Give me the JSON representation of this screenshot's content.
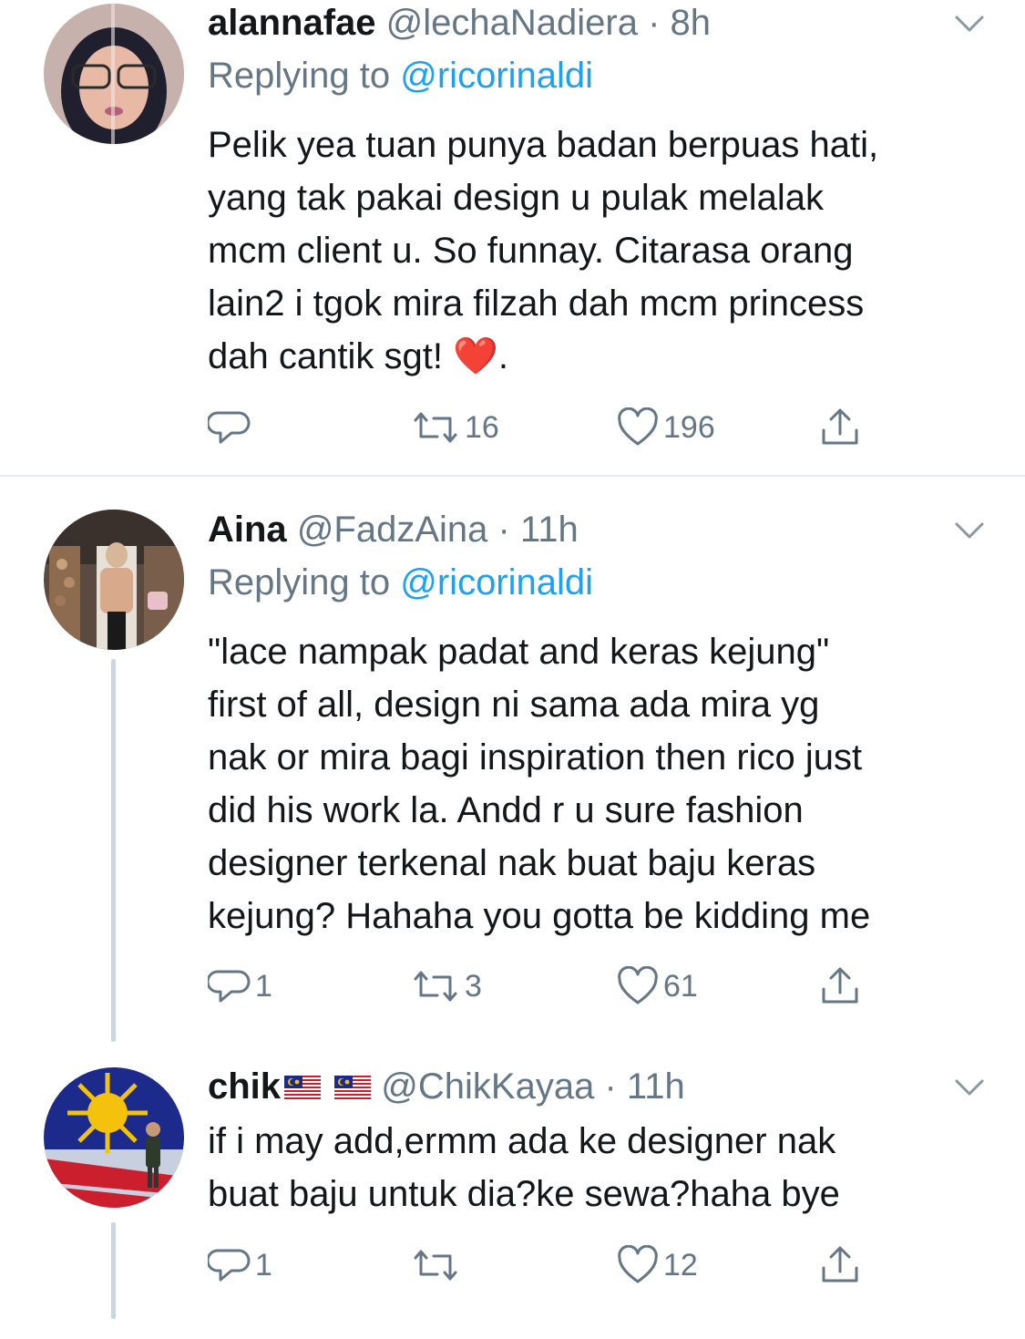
{
  "tweets": [
    {
      "display_name": "alannafae",
      "handle": "@lechaNadiera",
      "separator": "·",
      "time": "8h",
      "replying_prefix": "Replying to",
      "replying_to": "@ricorinaldi",
      "lines": [
        "Pelik yea tuan punya badan berpuas hati,",
        "yang tak pakai design u pulak melalak",
        "mcm client u. So funnay. Citarasa orang",
        "lain2 i tgok mira filzah dah mcm princess",
        "dah cantik sgt! ❤️."
      ],
      "replies": "",
      "retweets": "16",
      "likes": "196"
    },
    {
      "display_name": "Aina",
      "handle": "@FadzAina",
      "separator": "·",
      "time": "11h",
      "replying_prefix": "Replying to",
      "replying_to": "@ricorinaldi",
      "lines": [
        "\"lace nampak padat and keras kejung\"",
        "first of all, design ni sama ada mira yg",
        "nak or mira bagi inspiration then rico just",
        "did his work la. Andd r u sure fashion",
        "designer terkenal nak buat baju keras",
        "kejung? Hahaha you gotta be kidding me"
      ],
      "replies": "1",
      "retweets": "3",
      "likes": "61"
    },
    {
      "display_name": "chik",
      "handle": "@ChikKayaa",
      "separator": "·",
      "time": "11h",
      "lines": [
        "if i may add,ermm ada ke designer nak",
        "buat baju untuk dia?ke sewa?haha bye"
      ],
      "replies": "1",
      "retweets": "",
      "likes": "12"
    }
  ],
  "icons": {
    "reply": "reply-icon",
    "retweet": "retweet-icon",
    "like": "heart-icon",
    "share": "share-icon",
    "more": "chevron-down-icon",
    "flag": "malaysia-flag-icon"
  },
  "colors": {
    "text": "#14171a",
    "secondary": "#657786",
    "link": "#1da1f2",
    "heart": "#e0245e",
    "divider": "#e6ecf0",
    "thread_line": "#ccd6dd"
  }
}
